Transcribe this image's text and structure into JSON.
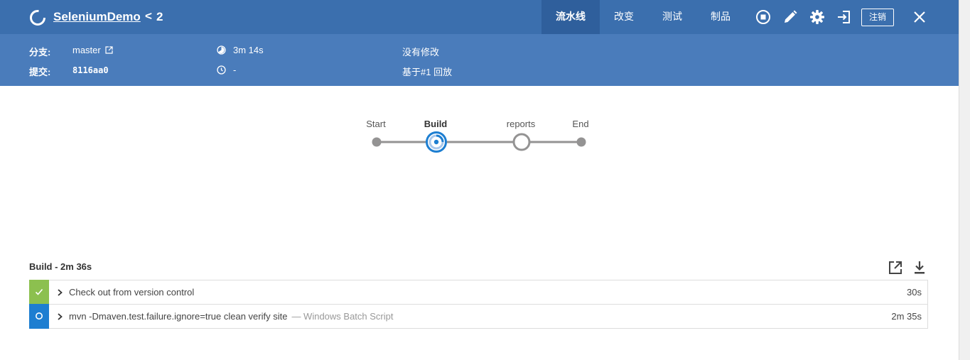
{
  "header": {
    "project_name": "SeleniumDemo",
    "back_glyph": "<",
    "run_number": "2",
    "tabs": [
      "流水线",
      "改变",
      "测试",
      "制品"
    ],
    "logout_label": "注销",
    "icons": [
      "stop-icon",
      "edit-icon",
      "gear-icon",
      "exit-icon",
      "close-icon"
    ]
  },
  "info": {
    "branch_label": "分支:",
    "branch_value": "master",
    "commit_label": "提交:",
    "commit_value": "8116aa0",
    "duration": "3m 14s",
    "time_ago": "-",
    "changes": "没有修改",
    "replay": "基于#1 回放"
  },
  "pipeline": {
    "stages": [
      {
        "label": "Start",
        "state": "start"
      },
      {
        "label": "Build",
        "state": "running"
      },
      {
        "label": "reports",
        "state": "queued"
      },
      {
        "label": "End",
        "state": "end"
      }
    ]
  },
  "section": {
    "title": "Build - 2m 36s",
    "steps": [
      {
        "text": "Check out from version control",
        "sub": "",
        "duration": "30s",
        "status": "success"
      },
      {
        "text": "mvn -Dmaven.test.failure.ignore=true clean verify site",
        "sub": "— Windows Batch Script",
        "duration": "2m 35s",
        "status": "running"
      }
    ]
  },
  "colors": {
    "header_bg": "#3b6fae",
    "info_bg": "#4a7cbb",
    "success": "#8cc04f",
    "running": "#1d7ed1"
  }
}
